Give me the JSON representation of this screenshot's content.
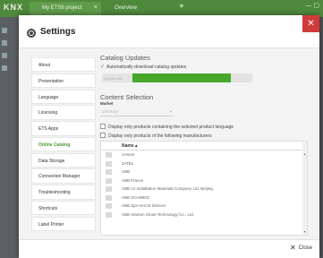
{
  "app": {
    "logo": "KNX",
    "tabs": [
      {
        "label": "My ETS6 project"
      },
      {
        "label": "Overview"
      }
    ]
  },
  "dialog": {
    "title": "Settings",
    "close_label": "Close"
  },
  "nav": {
    "items": [
      {
        "label": "About"
      },
      {
        "label": "Presentation"
      },
      {
        "label": "Language"
      },
      {
        "label": "Licensing"
      },
      {
        "label": "ETS Apps"
      },
      {
        "label": "Online Catalog",
        "active": true
      },
      {
        "label": "Data Storage"
      },
      {
        "label": "Connection Manager"
      },
      {
        "label": "Troubleshooting"
      },
      {
        "label": "Shortcuts"
      },
      {
        "label": "Label Printer"
      }
    ]
  },
  "catalog_updates": {
    "heading": "Catalog Updates",
    "auto_download_label": "Automatically download catalog updates",
    "update_button": "Update now",
    "progress": 0.82
  },
  "content_selection": {
    "heading": "Content Selection",
    "market_label": "Market",
    "market_value": "Germany",
    "option_language": "Display only products containing the selected product language",
    "option_manufacturers": "Display only products of the following manufacturers"
  },
  "manufacturers": {
    "column_header": "Name",
    "rows": [
      {
        "name": "1Home"
      },
      {
        "name": "3ATEL"
      },
      {
        "name": "ABB"
      },
      {
        "name": "ABB France"
      },
      {
        "name": "ABB LV Installation Materials Company Ltd, Beijing"
      },
      {
        "name": "ABB SCHWEIZ"
      },
      {
        "name": "ABB SpA-SACE Division"
      },
      {
        "name": "ABB Xiamen Smart Technology Co., Ltd."
      }
    ]
  },
  "colors": {
    "accent": "#4a9a2e",
    "titlebar": "#4f8a3c",
    "close": "#d13a3a"
  }
}
